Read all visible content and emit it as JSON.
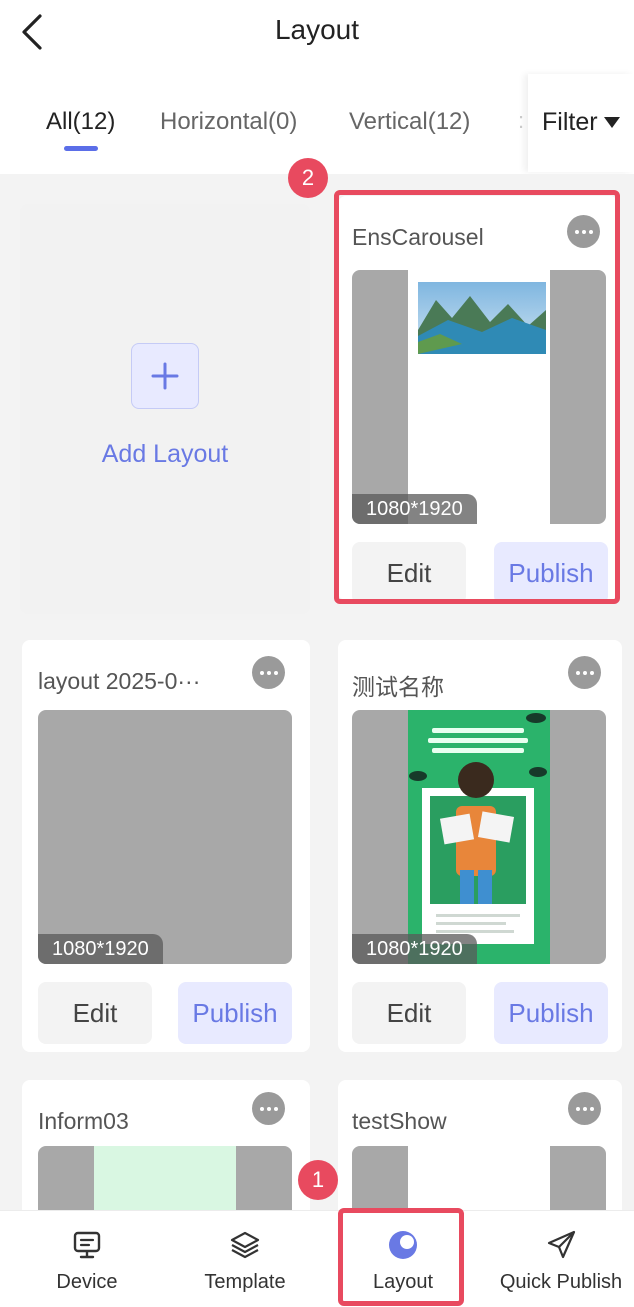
{
  "header": {
    "title": "Layout"
  },
  "tabs": [
    {
      "label": "All(12)"
    },
    {
      "label": "Horizontal(0)"
    },
    {
      "label": "Vertical(12)"
    }
  ],
  "tab_more": ":",
  "filter": {
    "label": "Filter"
  },
  "add_card": {
    "label": "Add Layout"
  },
  "cards": [
    {
      "title": "EnsCarousel",
      "resolution": "1080*1920",
      "edit_label": "Edit",
      "publish_label": "Publish"
    },
    {
      "title": "layout 2025-0···",
      "resolution": "1080*1920",
      "edit_label": "Edit",
      "publish_label": "Publish"
    },
    {
      "title": "测试名称",
      "resolution": "1080*1920",
      "edit_label": "Edit",
      "publish_label": "Publish"
    },
    {
      "title": "Inform03"
    },
    {
      "title": "testShow"
    }
  ],
  "step_badges": [
    "1",
    "2"
  ],
  "bottom_nav": [
    {
      "label": "Device",
      "icon": "monitor-icon"
    },
    {
      "label": "Template",
      "icon": "layers-icon"
    },
    {
      "label": "Layout",
      "icon": "layout-circle-icon"
    },
    {
      "label": "Quick Publish",
      "icon": "paper-plane-icon"
    }
  ],
  "colors": {
    "accent": "#6979e4",
    "highlight": "#e84a5f",
    "thumb_gray": "#a8a8a8"
  }
}
